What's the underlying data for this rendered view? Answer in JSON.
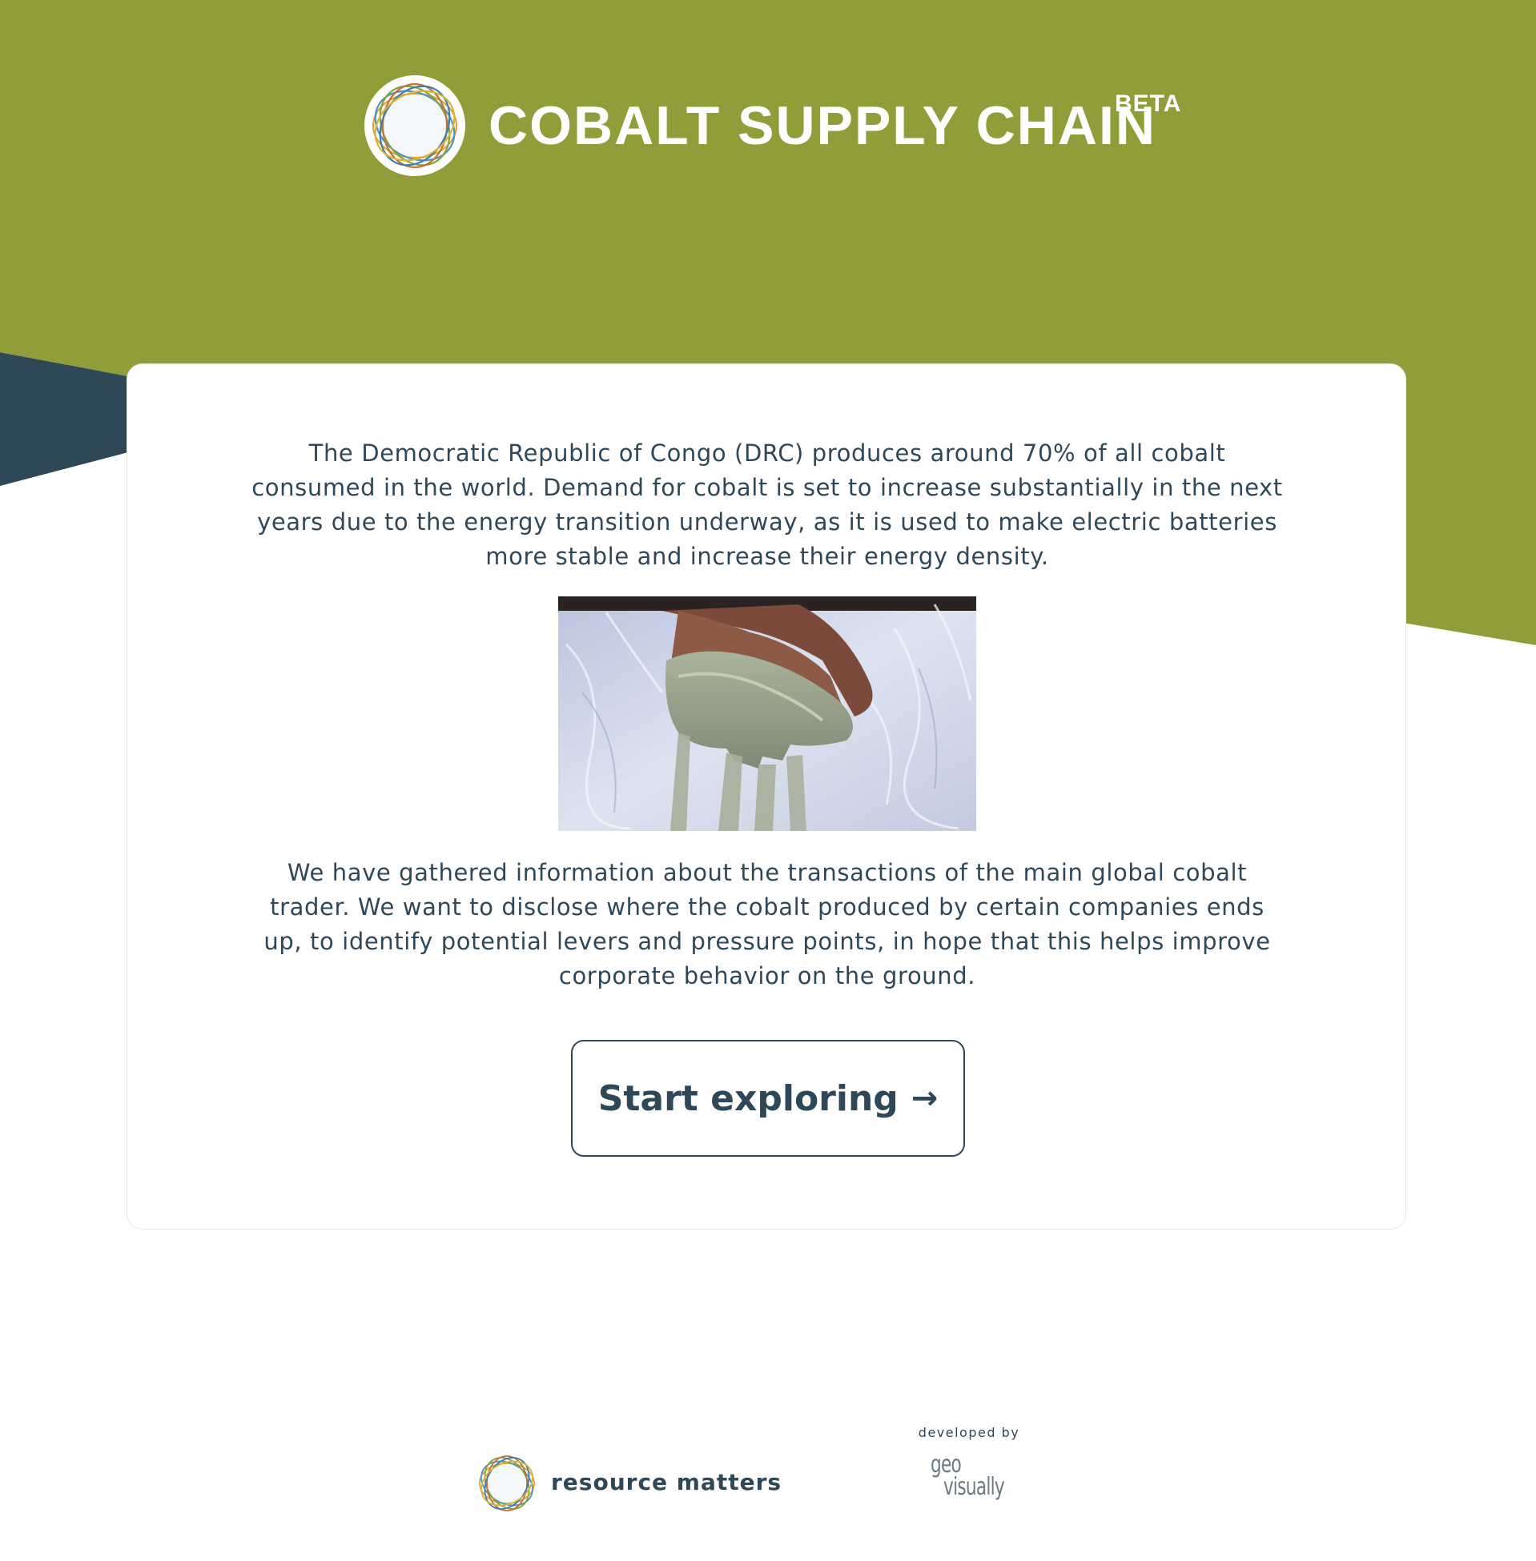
{
  "colors": {
    "header_green": "#909d38",
    "slate": "#2f4858",
    "text": "#2f4858",
    "background": "#ffffff"
  },
  "header": {
    "logo_icon": "resource-matters-ring-logo",
    "title": "COBALT SUPPLY CHAIN",
    "badge": "BETA"
  },
  "main": {
    "intro": "The Democratic Republic of Congo (DRC) produces around 70% of all cobalt consumed in the world. Demand for cobalt is set to increase substantially in the next years due to the energy transition underway, as it is used to make electric batteries more stable and increase their energy density.",
    "image_subject": "hand-holding-cobalt-ore-photo",
    "body": "We have gathered information about the transactions of the main global cobalt trader. We want to disclose where the cobalt produced by certain companies ends up, to identify potential levers and pressure points, in hope that this helps improve corporate behavior on the ground.",
    "cta_label": "Start exploring",
    "cta_icon": "→"
  },
  "footer": {
    "partner_name": "resource matters",
    "developed_by": "developed by",
    "developer_logo_line1": "geo",
    "developer_logo_line2": "visually"
  }
}
